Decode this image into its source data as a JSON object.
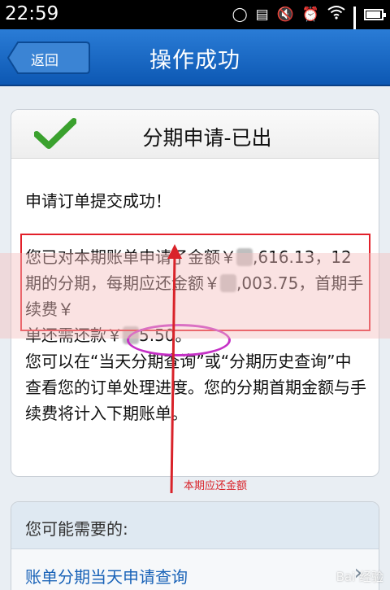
{
  "status_bar": {
    "time": "22:59",
    "icons": [
      "chat-icon",
      "image-icon",
      "mute-icon",
      "alarm-icon",
      "wifi-icon",
      "signal-icon",
      "battery-icon"
    ]
  },
  "header": {
    "back_label": "返回",
    "title": "操作成功"
  },
  "card": {
    "title": "分期申请-已出",
    "success_text": "申请订单提交成功！",
    "line1": "您已对本期账单申请了金额￥",
    "line1_tail": ",616.13，12期的分期，每期应还金额￥",
    "line2_tail": ",003.75，首期手续费￥",
    "line3": "单还需还款￥",
    "line3_tail": "5.50。",
    "line4": "您可以在“当天分期查询”或“分期历史查询”中查看您的订单处理进度。您的分期首期金额与手续费将计入下期账单。"
  },
  "annotation": {
    "label": "本期应还金额",
    "color": "#d9232a"
  },
  "suggest": {
    "title": "您可能需要的:",
    "link": "账单分期当天申请查询"
  },
  "watermark": "Bai 经验",
  "colors": {
    "titlebar": "#0d58b3",
    "highlight_box": "#e2202a",
    "ellipse": "#c531c6"
  }
}
